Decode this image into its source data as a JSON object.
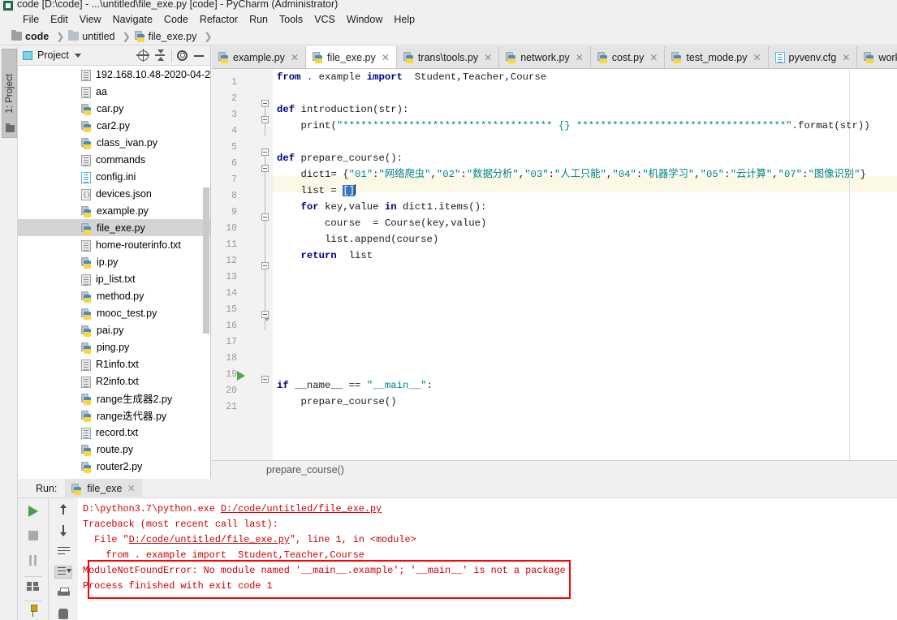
{
  "window": {
    "title": "code [D:\\code] - ...\\untitled\\file_exe.py [code] - PyCharm (Administrator)",
    "app_icon": "pycharm-icon"
  },
  "menubar": {
    "items": [
      "File",
      "Edit",
      "View",
      "Navigate",
      "Code",
      "Refactor",
      "Run",
      "Tools",
      "VCS",
      "Window",
      "Help"
    ]
  },
  "breadcrumb": {
    "items": [
      {
        "label": "code",
        "icon": "folder-icon"
      },
      {
        "label": "untitled",
        "icon": "folder-icon"
      },
      {
        "label": "file_exe.py",
        "icon": "python-file-icon"
      }
    ]
  },
  "left_strip": {
    "project_tab": "1: Project"
  },
  "project_panel": {
    "title": "Project",
    "toolbar": [
      "target-icon",
      "collapse-all-icon",
      "gear-icon",
      "minimize-icon"
    ],
    "tree": [
      {
        "label": "192.168.10.48-2020-04-2",
        "icon": "text-file-icon",
        "selected": false
      },
      {
        "label": "aa",
        "icon": "text-file-icon",
        "selected": false
      },
      {
        "label": "car.py",
        "icon": "python-file-icon",
        "selected": false
      },
      {
        "label": "car2.py",
        "icon": "python-file-icon",
        "selected": false
      },
      {
        "label": "class_ivan.py",
        "icon": "python-file-icon",
        "selected": false
      },
      {
        "label": "commands",
        "icon": "text-file-icon",
        "selected": false
      },
      {
        "label": "config.ini",
        "icon": "config-file-icon",
        "selected": false
      },
      {
        "label": "devices.json",
        "icon": "json-file-icon",
        "selected": false
      },
      {
        "label": "example.py",
        "icon": "python-file-icon",
        "selected": false
      },
      {
        "label": "file_exe.py",
        "icon": "python-file-icon",
        "selected": true
      },
      {
        "label": "home-routerinfo.txt",
        "icon": "text-file-icon",
        "selected": false
      },
      {
        "label": "ip.py",
        "icon": "python-file-icon",
        "selected": false
      },
      {
        "label": "ip_list.txt",
        "icon": "text-file-icon",
        "selected": false
      },
      {
        "label": "method.py",
        "icon": "python-file-icon",
        "selected": false
      },
      {
        "label": "mooc_test.py",
        "icon": "python-file-icon",
        "selected": false
      },
      {
        "label": "pai.py",
        "icon": "python-file-icon",
        "selected": false
      },
      {
        "label": "ping.py",
        "icon": "python-file-icon",
        "selected": false
      },
      {
        "label": "R1info.txt",
        "icon": "text-file-icon",
        "selected": false
      },
      {
        "label": "R2info.txt",
        "icon": "text-file-icon",
        "selected": false
      },
      {
        "label": "range生成器2.py",
        "icon": "python-file-icon",
        "selected": false
      },
      {
        "label": "range迭代器.py",
        "icon": "python-file-icon",
        "selected": false
      },
      {
        "label": "record.txt",
        "icon": "text-file-icon",
        "selected": false
      },
      {
        "label": "route.py",
        "icon": "python-file-icon",
        "selected": false
      },
      {
        "label": "router2.py",
        "icon": "python-file-icon",
        "selected": false
      }
    ]
  },
  "editor_tabs": [
    {
      "label": "example.py",
      "icon": "python-file-icon",
      "active": false
    },
    {
      "label": "file_exe.py",
      "icon": "python-file-icon",
      "active": true
    },
    {
      "label": "trans\\tools.py",
      "icon": "python-file-icon",
      "active": false
    },
    {
      "label": "network.py",
      "icon": "python-file-icon",
      "active": false
    },
    {
      "label": "cost.py",
      "icon": "python-file-icon",
      "active": false
    },
    {
      "label": "test_mode.py",
      "icon": "python-file-icon",
      "active": false
    },
    {
      "label": "pyvenv.cfg",
      "icon": "config-file-icon",
      "active": false
    },
    {
      "label": "work\\",
      "icon": "python-file-icon",
      "active": false
    }
  ],
  "editor": {
    "line_numbers": [
      "1",
      "2",
      "3",
      "4",
      "5",
      "6",
      "7",
      "8",
      "9",
      "10",
      "11",
      "12",
      "13",
      "14",
      "15",
      "16",
      "17",
      "18",
      "19",
      "20",
      "21"
    ],
    "highlighted_line": 8,
    "caret_line": 8,
    "run_marker_line": 20,
    "code_lines": [
      "from . example import  Student,Teacher,Course",
      "",
      "def introduction(str):",
      "    print(\"*********************************** {} ***********************************\".format(str))",
      "",
      "def prepare_course():",
      "    dict1= {\"01\":\"网络爬虫\",\"02\":\"数据分析\",\"03\":\"人工只能\",\"04\":\"机器学习\",\"05\":\"云计算\",\"07\":\"图像识别\"}",
      "    list = []",
      "    for key,value in dict1.items():",
      "        course  = Course(key,value)",
      "        list.append(course)",
      "    return  list",
      "",
      "",
      "",
      "",
      "",
      "",
      "",
      "if __name__ == \"__main__\":",
      "    prepare_course()"
    ],
    "breadcrumb_status": "prepare_course()"
  },
  "run_panel": {
    "label": "Run:",
    "tab_label": "file_exe",
    "tab_icon": "python-file-icon",
    "left_toolbar": [
      "run-icon",
      "stop-icon",
      "pause-icon",
      "layout-icon",
      "pin-icon"
    ],
    "right_toolbar": [
      "arrow-up-icon",
      "arrow-down-icon",
      "soft-wrap-icon",
      "scroll-to-end-icon",
      "print-icon",
      "trash-icon"
    ],
    "console_lines": [
      "D:\\python3.7\\python.exe D:/code/untitled/file_exe.py",
      "Traceback (most recent call last):",
      "  File \"D:/code/untitled/file_exe.py\", line 1, in <module>",
      "    from . example import  Student,Teacher,Course",
      "ModuleNotFoundError: No module named '__main__.example'; '__main__' is not a package",
      "",
      "Process finished with exit code 1"
    ],
    "console_link": "D:/code/untitled/file_exe.py",
    "error_highlight_color": "#ff0000",
    "console_text_color": "#cc0000"
  },
  "colors": {
    "keyword": "#000080",
    "string": "#008080",
    "background": "#ffffff",
    "selection": "#3a74c4",
    "highlight_row": "#fcf8e6",
    "chrome": "#f0f0f0"
  }
}
